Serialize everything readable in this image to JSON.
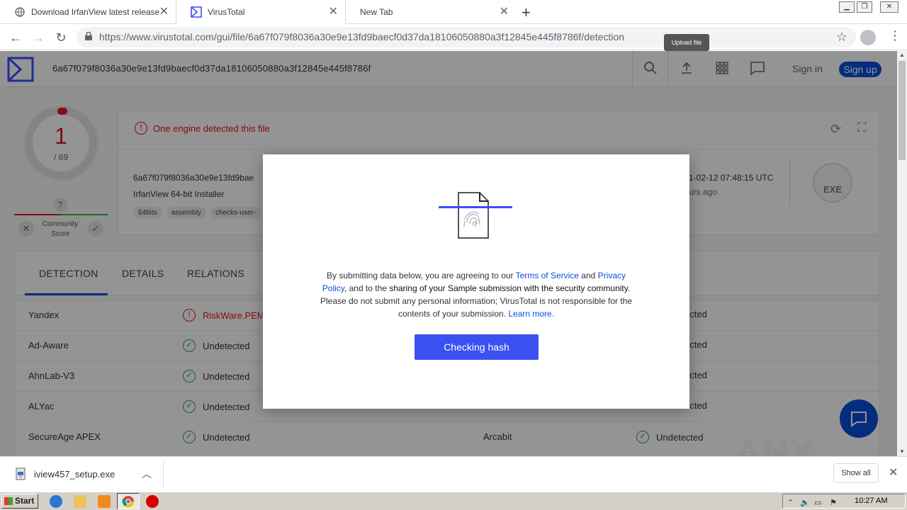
{
  "browser": {
    "tabs": [
      {
        "title": "Download IrfanView latest release"
      },
      {
        "title": "VirusTotal"
      },
      {
        "title": "New Tab"
      }
    ],
    "url": "https://www.virustotal.com/gui/file/6a67f079f8036a30e9e13fd9baecf0d37da18106050880a3f12845e445f8786f/detection"
  },
  "vt": {
    "search_value": "6a67f079f8036a30e9e13fd9baecf0d37da18106050880a3f12845e445f8786f",
    "signin": "Sign in",
    "signup": "Sign up",
    "upload_tooltip": "Upload file",
    "score": {
      "detected": "1",
      "total": "/ 69"
    },
    "community": {
      "q": "?",
      "label": "Community Score"
    },
    "banner": "One engine detected this file",
    "file": {
      "hash": "6a67f079f8036a30e9e13fd9bae",
      "name": "IrfanView 64-bit Installer",
      "tags": [
        "64bits",
        "assembly",
        "checks-user-"
      ],
      "date": "1-02-12 07:48:15 UTC",
      "ago": "urs ago",
      "type": "EXE"
    },
    "tabs": [
      "DETECTION",
      "DETAILS",
      "RELATIONS"
    ],
    "results": [
      {
        "engine": "Yandex",
        "result": "RiskWare.PEMal",
        "bad": true,
        "engine2": "",
        "result2": "ected"
      },
      {
        "engine": "Ad-Aware",
        "result": "Undetected",
        "bad": false,
        "engine2": "",
        "result2": "ected"
      },
      {
        "engine": "AhnLab-V3",
        "result": "Undetected",
        "bad": false,
        "engine2": "",
        "result2": "ected"
      },
      {
        "engine": "ALYac",
        "result": "Undetected",
        "bad": false,
        "engine2": "",
        "result2": "ected"
      },
      {
        "engine": "SecureAge APEX",
        "result": "Undetected",
        "bad": false,
        "engine2": "Arcabit",
        "result2": "Undetected"
      }
    ]
  },
  "modal": {
    "text_a": "By submitting data below, you are agreeing to our ",
    "tos": "Terms of Service",
    "text_b": " and ",
    "privacy": "Privacy Policy",
    "text_c": ", and to the ",
    "bold": "sharing of your Sample submission with the security community.",
    "text_d": " Please do not submit any personal information; VirusTotal is not responsible for the contents of your submission. ",
    "learn": "Learn more.",
    "button": "Checking hash"
  },
  "watermark": "ANY RUN",
  "downloads": {
    "file": "iview457_setup.exe",
    "show_all": "Show all"
  },
  "taskbar": {
    "start": "Start",
    "clock": "10:27 AM"
  },
  "colors": {
    "vt_blue": "#0b4dda",
    "detect_red": "#e6141e",
    "ok_green": "#2e9f4f",
    "modal_button": "#3b50f0"
  }
}
